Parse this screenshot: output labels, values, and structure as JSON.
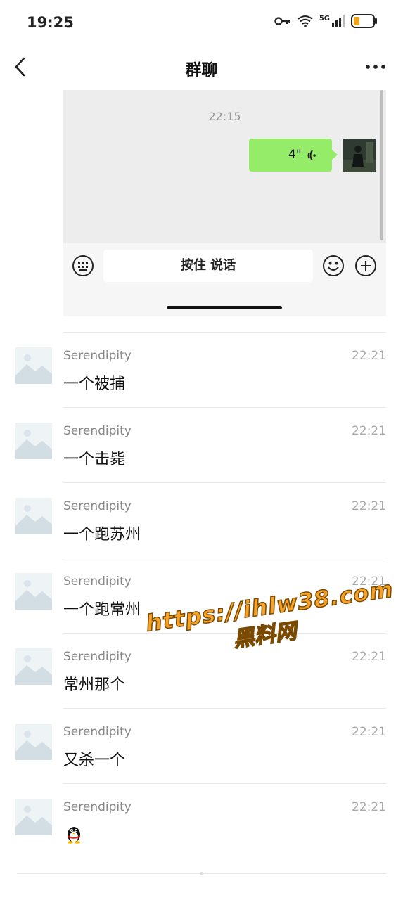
{
  "status_bar": {
    "time": "19:25",
    "network": "5G",
    "icons": [
      "key-icon",
      "wifi-icon",
      "signal-icon",
      "battery-icon"
    ]
  },
  "header": {
    "title": "群聊",
    "icons": [
      "back-icon",
      "more-icon"
    ]
  },
  "embedded_chat": {
    "timestamp": "22:15",
    "voice_message": {
      "duration": "4\"",
      "bubble_color": "#95ec69"
    },
    "input_bar": {
      "hold_to_talk_label": "按住 说话",
      "icons": [
        "keyboard-icon",
        "emoji-icon",
        "plus-icon"
      ]
    }
  },
  "messages": [
    {
      "sender": "Serendipity",
      "time": "22:21",
      "text": "一个被捕"
    },
    {
      "sender": "Serendipity",
      "time": "22:21",
      "text": "一个击毙"
    },
    {
      "sender": "Serendipity",
      "time": "22:21",
      "text": "一个跑苏州"
    },
    {
      "sender": "Serendipity",
      "time": "22:21",
      "text": "一个跑常州"
    },
    {
      "sender": "Serendipity",
      "time": "22:21",
      "text": "常州那个"
    },
    {
      "sender": "Serendipity",
      "time": "22:21",
      "text": "又杀一个"
    },
    {
      "sender": "Serendipity",
      "time": "22:21",
      "text": "",
      "sticker": "qq-penguin-icon"
    }
  ],
  "watermark": {
    "url": "https://ihlw38.com",
    "label": "黑料网"
  }
}
